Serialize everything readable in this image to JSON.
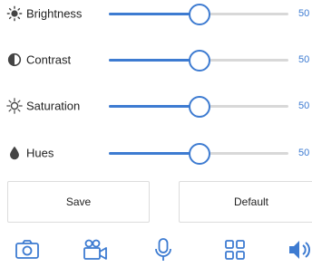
{
  "adjustments": [
    {
      "id": "brightness",
      "label": "Brightness",
      "value": 50,
      "max": 100,
      "value_text": "50",
      "icon": "brightness-icon"
    },
    {
      "id": "contrast",
      "label": "Contrast",
      "value": 50,
      "max": 100,
      "value_text": "50",
      "icon": "contrast-icon"
    },
    {
      "id": "saturation",
      "label": "Saturation",
      "value": 50,
      "max": 100,
      "value_text": "50",
      "icon": "saturation-icon"
    },
    {
      "id": "hues",
      "label": "Hues",
      "value": 50,
      "max": 100,
      "value_text": "50",
      "icon": "hue-drop-icon"
    }
  ],
  "buttons": {
    "save_label": "Save",
    "default_label": "Default"
  },
  "toolbar": {
    "items": [
      {
        "icon": "camera-icon"
      },
      {
        "icon": "video-camera-icon"
      },
      {
        "icon": "microphone-icon"
      },
      {
        "icon": "grid-icon"
      },
      {
        "icon": "speaker-icon",
        "active": true
      }
    ]
  },
  "colors": {
    "accent": "#3d7bd1",
    "track": "#d8d8d8",
    "icon": "#555555"
  }
}
